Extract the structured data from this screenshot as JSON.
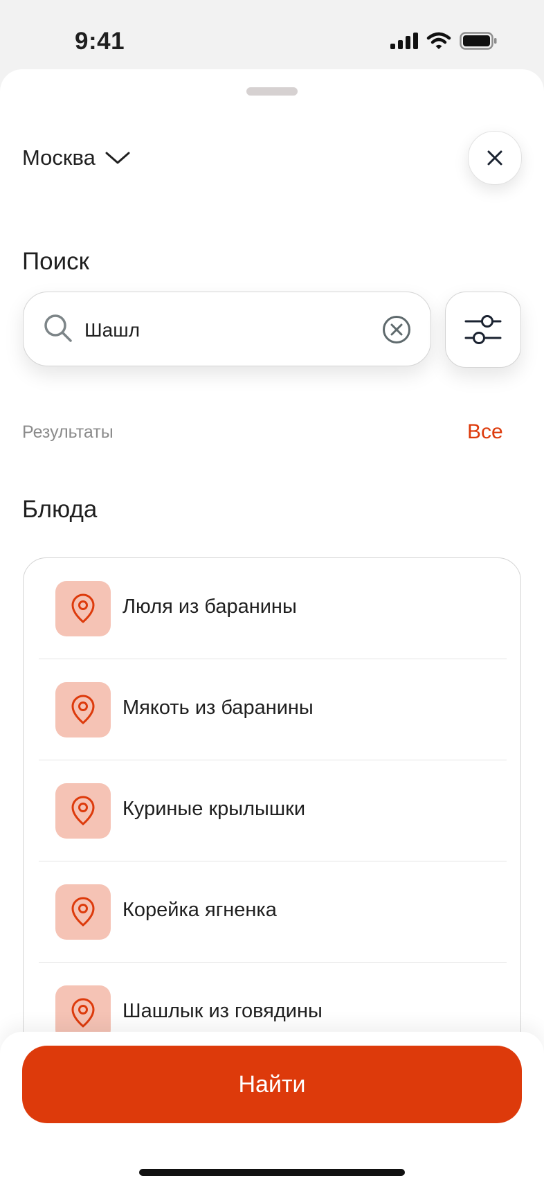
{
  "status_bar": {
    "time": "9:41"
  },
  "header": {
    "city": "Москва"
  },
  "search": {
    "title": "Поиск",
    "value": "Шашл"
  },
  "results": {
    "label": "Результаты",
    "all_link": "Все"
  },
  "dishes": {
    "title": "Блюда",
    "items": [
      {
        "label": "Люля из баранины",
        "icon": "location-pin-icon"
      },
      {
        "label": "Мякоть из баранины",
        "icon": "location-pin-icon"
      },
      {
        "label": "Куриные крылышки",
        "icon": "location-pin-icon"
      },
      {
        "label": "Корейка ягненка",
        "icon": "location-pin-icon"
      },
      {
        "label": "Шашлык из говядины",
        "icon": "location-pin-icon"
      }
    ]
  },
  "action": {
    "find_label": "Найти"
  },
  "colors": {
    "accent": "#dd3a0b",
    "icon_bg": "#f5c3b5",
    "muted_text": "#8b8b8b"
  }
}
